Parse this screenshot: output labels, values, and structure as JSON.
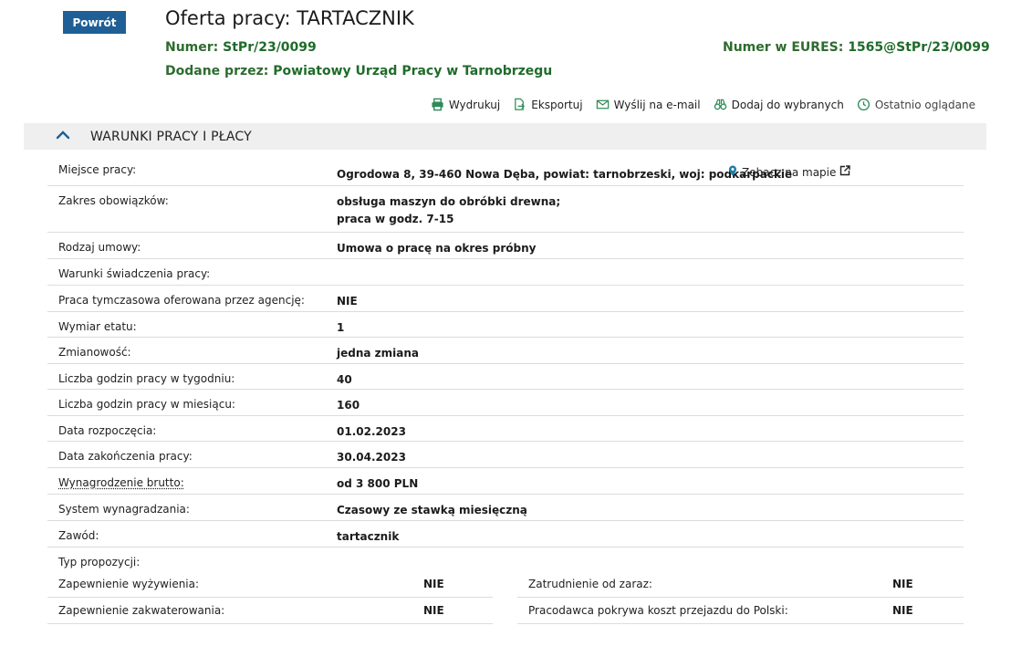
{
  "back_button": "Powrót",
  "title": "Oferta pracy: TARTACZNIK",
  "number": {
    "label": "Numer:",
    "value": "StPr/23/0099"
  },
  "eures": {
    "label": "Numer w EURES:",
    "value": "1565@StPr/23/0099"
  },
  "added_by": {
    "label": "Dodane przez:",
    "value": "Powiatowy Urząd Pracy w Tarnobrzegu"
  },
  "actions": [
    {
      "label": "Wydrukuj",
      "icon": "printer-icon"
    },
    {
      "label": "Eksportuj",
      "icon": "export-icon"
    },
    {
      "label": "Wyślij na e-mail",
      "icon": "envelope-icon"
    },
    {
      "label": "Dodaj do wybranych",
      "icon": "binoculars-icon"
    },
    {
      "label": "Ostatnio oglądane",
      "icon": "clock-icon"
    }
  ],
  "section": {
    "title": "WARUNKI PRACY I PŁACY"
  },
  "rows": [
    {
      "label": "Miejsce pracy:",
      "value": "Ogrodowa 8, 39-460 Nowa Dęba, powiat: tarnobrzeski, woj: podkarpackie",
      "map_link": "Zobacz na mapie"
    },
    {
      "label": "Zakres obowiązków:",
      "value_lines": [
        "obsługa maszyn do obróbki drewna;",
        "praca w godz. 7-15"
      ]
    },
    {
      "label": "Rodzaj umowy:",
      "value": "Umowa o pracę na okres próbny"
    },
    {
      "label": "Warunki świadczenia pracy:",
      "value": ""
    },
    {
      "label": "Praca tymczasowa oferowana przez agencję:",
      "value": "NIE"
    },
    {
      "label": "Wymiar etatu:",
      "value": "1"
    },
    {
      "label": "Zmianowość:",
      "value": "jedna zmiana"
    },
    {
      "label": "Liczba godzin pracy w tygodniu:",
      "value": "40"
    },
    {
      "label": "Liczba godzin pracy w miesiącu:",
      "value": "160"
    },
    {
      "label": "Data rozpoczęcia:",
      "value": "01.02.2023"
    },
    {
      "label": "Data zakończenia pracy:",
      "value": "30.04.2023"
    },
    {
      "label": "Wynagrodzenie brutto:",
      "value": "od 3 800 PLN"
    },
    {
      "label": "System wynagradzania:",
      "value": "Czasowy ze stawką miesięczną"
    },
    {
      "label": "Zawód:",
      "value": "tartacznik"
    }
  ],
  "proposal_type_label": "Typ propozycji:",
  "sub_left": [
    {
      "label": "Zapewnienie wyżywienia:",
      "value": "NIE"
    },
    {
      "label": "Zapewnienie zakwaterowania:",
      "value": "NIE"
    }
  ],
  "sub_right": [
    {
      "label": "Zatrudnienie od zaraz:",
      "value": "NIE"
    },
    {
      "label": "Pracodawca pokrywa koszt przejazdu do Polski:",
      "value": "NIE"
    }
  ]
}
